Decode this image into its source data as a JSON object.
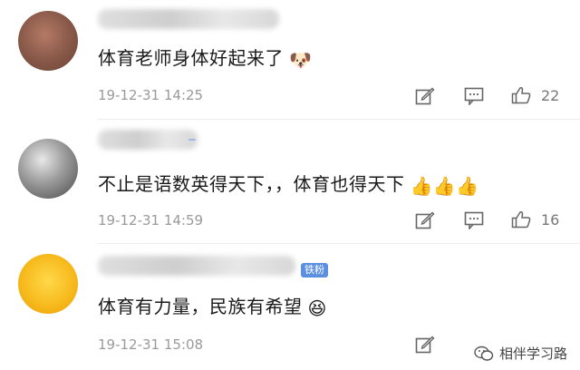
{
  "comments": [
    {
      "text": "体育老师身体好起来了",
      "emoji": "🐶",
      "emoji_name": "doge-emoji",
      "timestamp": "19-12-31 14:25",
      "likes": "22",
      "badge": ""
    },
    {
      "text": "不止是语数英得天下，，体育也得天下",
      "emoji": "👍👍👍",
      "emoji_name": "thumbs-up-emoji",
      "timestamp": "19-12-31 14:59",
      "likes": "16",
      "badge": ""
    },
    {
      "text": "体育有力量，民族有希望",
      "emoji": "😆",
      "emoji_name": "laughing-emoji",
      "timestamp": "19-12-31 15:08",
      "likes": "",
      "badge": "铁粉"
    }
  ],
  "icons": {
    "edit": "edit-icon",
    "comment": "comment-icon",
    "like": "thumbs-up-icon"
  },
  "watermark": {
    "text": "相伴学习路"
  },
  "colors": {
    "timestamp": "#9a9a9a",
    "icon": "#666666",
    "badge": "#5b8fe0"
  }
}
